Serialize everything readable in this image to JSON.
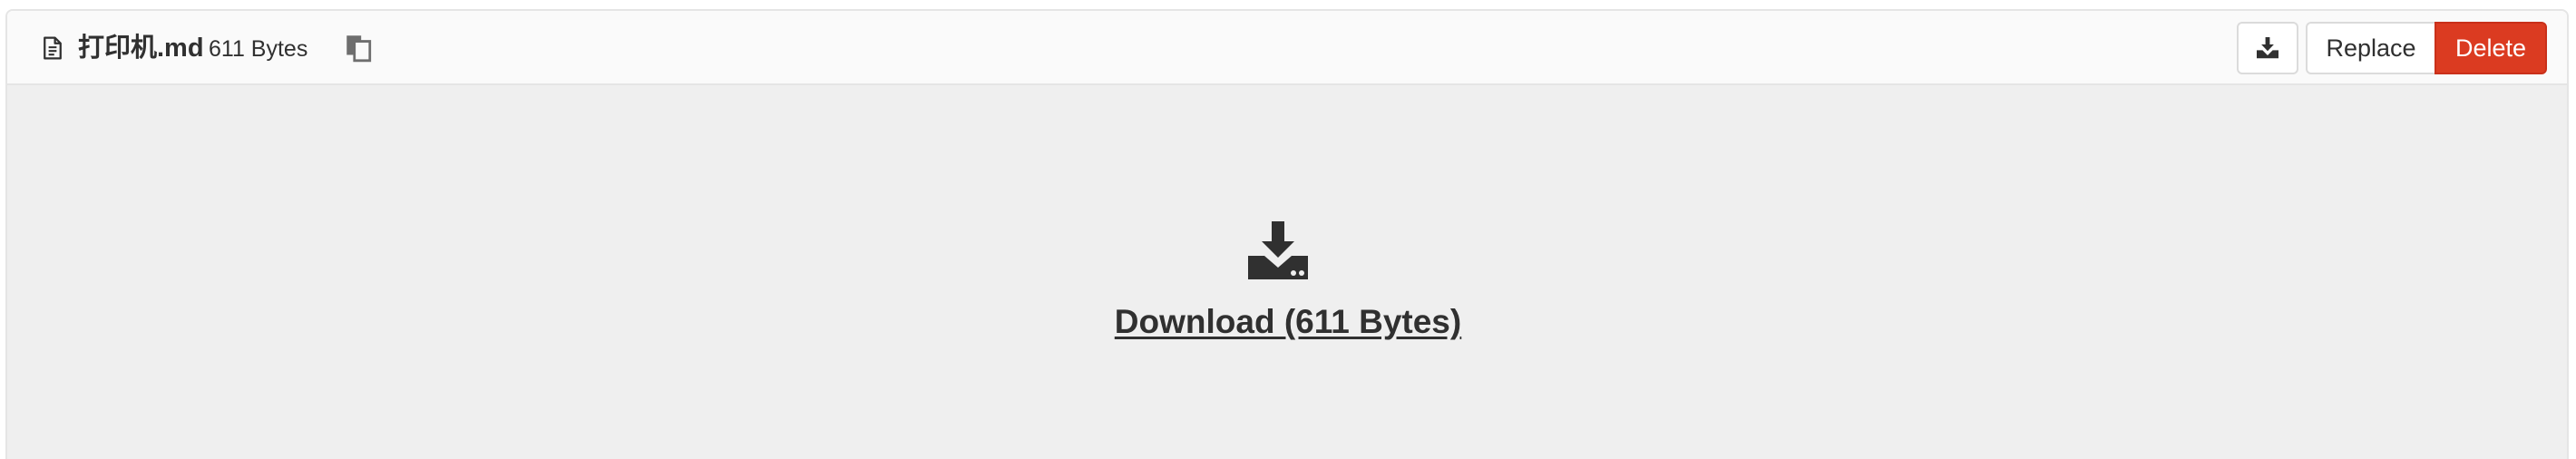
{
  "file": {
    "name": "打印机.md",
    "size": "611 Bytes"
  },
  "icons": {
    "file": "file-text-icon",
    "copy": "copy-icon",
    "download": "download-icon"
  },
  "actions": {
    "download_label": "",
    "replace_label": "Replace",
    "delete_label": "Delete"
  },
  "viewer": {
    "download_link": "Download (611 Bytes)"
  },
  "colors": {
    "delete": "#db3b21",
    "header_bg": "#fafafa",
    "body_bg": "#efefef"
  }
}
